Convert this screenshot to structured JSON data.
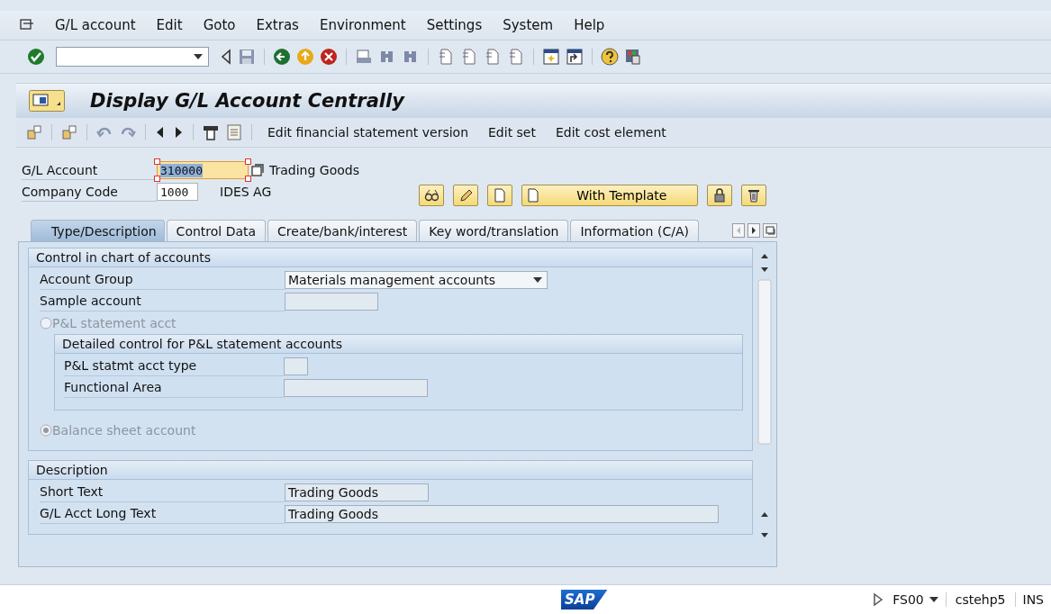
{
  "menu_bar": {
    "items": [
      "G/L account",
      "Edit",
      "Goto",
      "Extras",
      "Environment",
      "Settings",
      "System",
      "Help"
    ]
  },
  "title": "Display G/L Account Centrally",
  "app_toolbar": {
    "buttons": [
      "Edit financial statement version",
      "Edit set",
      "Edit cost element"
    ]
  },
  "header": [
    {
      "label": "G/L Account",
      "value": "310000",
      "description": "Trading Goods",
      "focused": true
    },
    {
      "label": "Company Code",
      "value": "1000",
      "description": "IDES AG",
      "focused": false
    }
  ],
  "template_button": "With Template",
  "tabs": [
    {
      "label": "Type/Description",
      "selected": true
    },
    {
      "label": "Control Data",
      "selected": false
    },
    {
      "label": "Create/bank/interest",
      "selected": false
    },
    {
      "label": "Key word/translation",
      "selected": false
    },
    {
      "label": "Information (C/A)",
      "selected": false
    }
  ],
  "sections": [
    {
      "title": "Control in chart of accounts",
      "rows": [
        {
          "kind": "dropdown",
          "label": "Account Group",
          "value": "Materials management accounts"
        },
        {
          "kind": "field",
          "label": "Sample account"
        },
        {
          "kind": "radio",
          "label": "P&L statement acct",
          "selected": false,
          "disabled": true
        },
        {
          "kind": "group",
          "title": "Detailed control for P&L statement accounts",
          "rows": [
            {
              "kind": "short_field",
              "label": "P&L statmt acct type"
            },
            {
              "kind": "medium_field",
              "label": "Functional Area"
            }
          ]
        },
        {
          "kind": "radio",
          "label": "Balance sheet account",
          "selected": true,
          "disabled": true
        }
      ]
    },
    {
      "title": "Description",
      "rows": [
        {
          "kind": "medium_field",
          "label": "Short Text",
          "value": "Trading Goods"
        },
        {
          "kind": "long_field",
          "label": "G/L Acct Long Text",
          "value": "Trading Goods"
        }
      ]
    }
  ],
  "status_bar": {
    "logo": "SAP",
    "transaction": "FS00",
    "server": "cstehp5",
    "mode": "INS"
  }
}
